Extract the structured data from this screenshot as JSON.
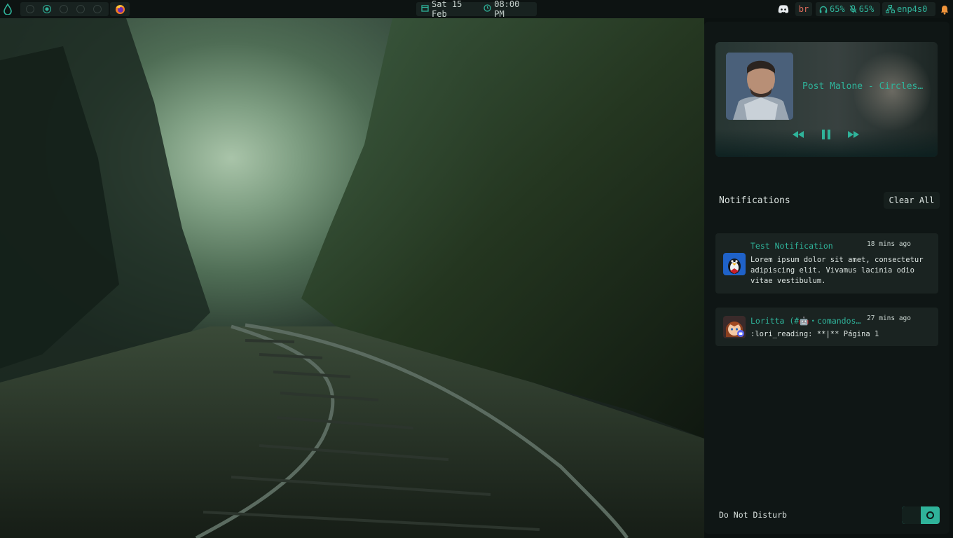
{
  "topbar": {
    "workspaces": [
      {
        "name": "workspace-1",
        "active": false
      },
      {
        "name": "workspace-2",
        "active": true
      },
      {
        "name": "workspace-3",
        "active": false
      },
      {
        "name": "workspace-4",
        "active": false
      },
      {
        "name": "workspace-5",
        "active": false
      }
    ],
    "clock": {
      "date": "Sat 15 Feb",
      "time": "08:00 PM"
    },
    "keyboard_layout": "br",
    "headphone_volume": "65%",
    "mic_volume": "65%",
    "network": "enp4s0",
    "icons": {
      "launcher": "droplet-icon",
      "browser": "firefox-icon",
      "calendar": "calendar-icon",
      "clock": "clock-icon",
      "chat": "discord-icon",
      "headphones": "headphones-icon",
      "mic": "mic-muted-icon",
      "network": "network-icon",
      "notifications": "bell-icon"
    }
  },
  "player": {
    "track": "Post Malone - Circles…",
    "controls": {
      "previous": "rewind-icon",
      "play_pause": "pause-icon",
      "next": "fast-forward-icon"
    }
  },
  "notifications": {
    "heading": "Notifications",
    "clear_label": "Clear All",
    "items": [
      {
        "title": "Test Notification",
        "time": "18 mins ago",
        "body": "Lorem ipsum dolor sit amet, consectetur adipiscing elit. Vivamus lacinia odio vitae vestibulum."
      },
      {
        "title": "Loritta (#🤖・comandos…",
        "time": "27 mins ago",
        "body": ":lori_reading: **|** Página 1"
      }
    ]
  },
  "dnd": {
    "label": "Do Not Disturb",
    "enabled": true
  },
  "colors": {
    "accent": "#2fb39a",
    "bar_bg": "#0d1312",
    "panel_bg": "#0f1615",
    "card_bg": "#1a2321",
    "alert": "#e06c5c"
  }
}
